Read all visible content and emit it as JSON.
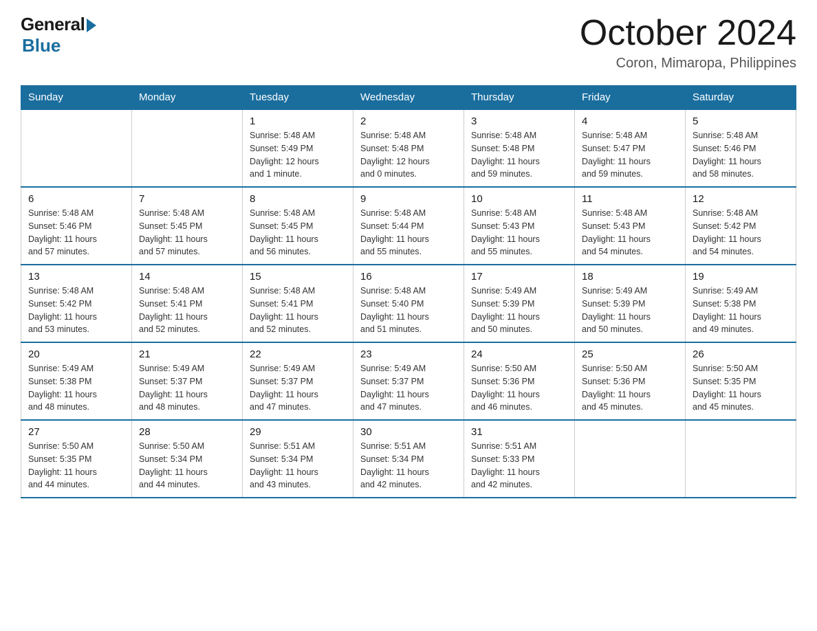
{
  "header": {
    "logo_general": "General",
    "logo_blue": "Blue",
    "month_title": "October 2024",
    "location": "Coron, Mimaropa, Philippines"
  },
  "calendar": {
    "days_of_week": [
      "Sunday",
      "Monday",
      "Tuesday",
      "Wednesday",
      "Thursday",
      "Friday",
      "Saturday"
    ],
    "weeks": [
      [
        {
          "day": "",
          "info": ""
        },
        {
          "day": "",
          "info": ""
        },
        {
          "day": "1",
          "info": "Sunrise: 5:48 AM\nSunset: 5:49 PM\nDaylight: 12 hours\nand 1 minute."
        },
        {
          "day": "2",
          "info": "Sunrise: 5:48 AM\nSunset: 5:48 PM\nDaylight: 12 hours\nand 0 minutes."
        },
        {
          "day": "3",
          "info": "Sunrise: 5:48 AM\nSunset: 5:48 PM\nDaylight: 11 hours\nand 59 minutes."
        },
        {
          "day": "4",
          "info": "Sunrise: 5:48 AM\nSunset: 5:47 PM\nDaylight: 11 hours\nand 59 minutes."
        },
        {
          "day": "5",
          "info": "Sunrise: 5:48 AM\nSunset: 5:46 PM\nDaylight: 11 hours\nand 58 minutes."
        }
      ],
      [
        {
          "day": "6",
          "info": "Sunrise: 5:48 AM\nSunset: 5:46 PM\nDaylight: 11 hours\nand 57 minutes."
        },
        {
          "day": "7",
          "info": "Sunrise: 5:48 AM\nSunset: 5:45 PM\nDaylight: 11 hours\nand 57 minutes."
        },
        {
          "day": "8",
          "info": "Sunrise: 5:48 AM\nSunset: 5:45 PM\nDaylight: 11 hours\nand 56 minutes."
        },
        {
          "day": "9",
          "info": "Sunrise: 5:48 AM\nSunset: 5:44 PM\nDaylight: 11 hours\nand 55 minutes."
        },
        {
          "day": "10",
          "info": "Sunrise: 5:48 AM\nSunset: 5:43 PM\nDaylight: 11 hours\nand 55 minutes."
        },
        {
          "day": "11",
          "info": "Sunrise: 5:48 AM\nSunset: 5:43 PM\nDaylight: 11 hours\nand 54 minutes."
        },
        {
          "day": "12",
          "info": "Sunrise: 5:48 AM\nSunset: 5:42 PM\nDaylight: 11 hours\nand 54 minutes."
        }
      ],
      [
        {
          "day": "13",
          "info": "Sunrise: 5:48 AM\nSunset: 5:42 PM\nDaylight: 11 hours\nand 53 minutes."
        },
        {
          "day": "14",
          "info": "Sunrise: 5:48 AM\nSunset: 5:41 PM\nDaylight: 11 hours\nand 52 minutes."
        },
        {
          "day": "15",
          "info": "Sunrise: 5:48 AM\nSunset: 5:41 PM\nDaylight: 11 hours\nand 52 minutes."
        },
        {
          "day": "16",
          "info": "Sunrise: 5:48 AM\nSunset: 5:40 PM\nDaylight: 11 hours\nand 51 minutes."
        },
        {
          "day": "17",
          "info": "Sunrise: 5:49 AM\nSunset: 5:39 PM\nDaylight: 11 hours\nand 50 minutes."
        },
        {
          "day": "18",
          "info": "Sunrise: 5:49 AM\nSunset: 5:39 PM\nDaylight: 11 hours\nand 50 minutes."
        },
        {
          "day": "19",
          "info": "Sunrise: 5:49 AM\nSunset: 5:38 PM\nDaylight: 11 hours\nand 49 minutes."
        }
      ],
      [
        {
          "day": "20",
          "info": "Sunrise: 5:49 AM\nSunset: 5:38 PM\nDaylight: 11 hours\nand 48 minutes."
        },
        {
          "day": "21",
          "info": "Sunrise: 5:49 AM\nSunset: 5:37 PM\nDaylight: 11 hours\nand 48 minutes."
        },
        {
          "day": "22",
          "info": "Sunrise: 5:49 AM\nSunset: 5:37 PM\nDaylight: 11 hours\nand 47 minutes."
        },
        {
          "day": "23",
          "info": "Sunrise: 5:49 AM\nSunset: 5:37 PM\nDaylight: 11 hours\nand 47 minutes."
        },
        {
          "day": "24",
          "info": "Sunrise: 5:50 AM\nSunset: 5:36 PM\nDaylight: 11 hours\nand 46 minutes."
        },
        {
          "day": "25",
          "info": "Sunrise: 5:50 AM\nSunset: 5:36 PM\nDaylight: 11 hours\nand 45 minutes."
        },
        {
          "day": "26",
          "info": "Sunrise: 5:50 AM\nSunset: 5:35 PM\nDaylight: 11 hours\nand 45 minutes."
        }
      ],
      [
        {
          "day": "27",
          "info": "Sunrise: 5:50 AM\nSunset: 5:35 PM\nDaylight: 11 hours\nand 44 minutes."
        },
        {
          "day": "28",
          "info": "Sunrise: 5:50 AM\nSunset: 5:34 PM\nDaylight: 11 hours\nand 44 minutes."
        },
        {
          "day": "29",
          "info": "Sunrise: 5:51 AM\nSunset: 5:34 PM\nDaylight: 11 hours\nand 43 minutes."
        },
        {
          "day": "30",
          "info": "Sunrise: 5:51 AM\nSunset: 5:34 PM\nDaylight: 11 hours\nand 42 minutes."
        },
        {
          "day": "31",
          "info": "Sunrise: 5:51 AM\nSunset: 5:33 PM\nDaylight: 11 hours\nand 42 minutes."
        },
        {
          "day": "",
          "info": ""
        },
        {
          "day": "",
          "info": ""
        }
      ]
    ]
  }
}
